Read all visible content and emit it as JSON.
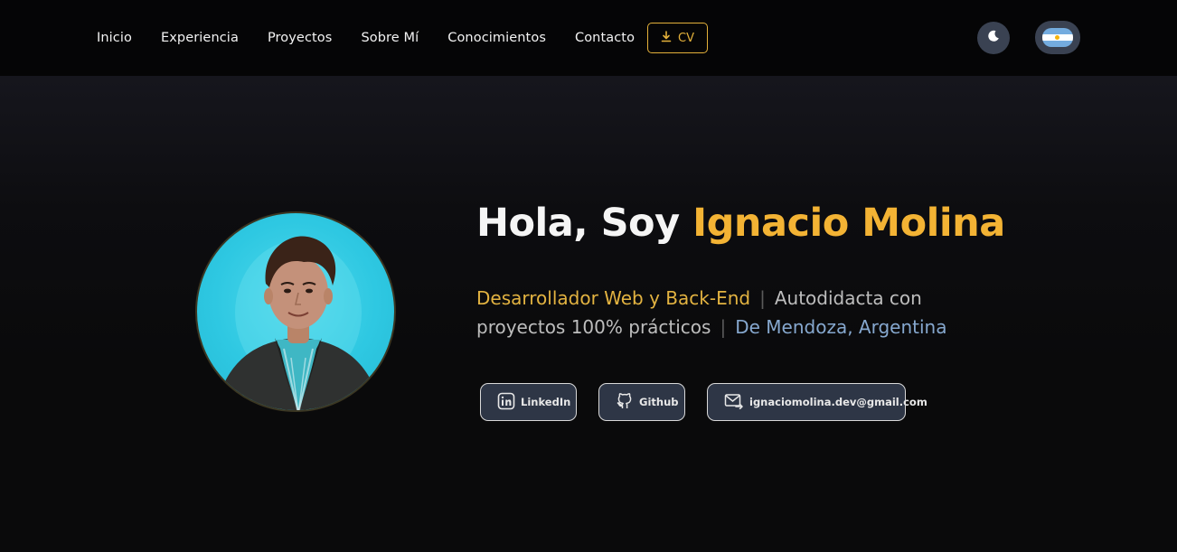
{
  "nav": {
    "links": [
      "Inicio",
      "Experiencia",
      "Proyectos",
      "Sobre Mí",
      "Conocimientos",
      "Contacto"
    ],
    "cv_label": "CV",
    "cv_icon": "download-icon",
    "theme_icon": "moon-icon",
    "language_flag": "argentina-flag-icon"
  },
  "hero": {
    "greeting_prefix": "Hola, Soy",
    "name": "Ignacio Molina",
    "role": "Desarrollador Web y Back-End",
    "separator": "|",
    "description": "Autodidacta con proyectos 100% prácticos",
    "location": "De Mendoza, Argentina"
  },
  "social": {
    "linkedin": "LinkedIn",
    "github": "Github",
    "email": "ignaciomolina.dev@gmail.com"
  },
  "colors": {
    "accent": "#f3b334",
    "location": "#86a8cf",
    "button_bg": "#2e3646"
  }
}
